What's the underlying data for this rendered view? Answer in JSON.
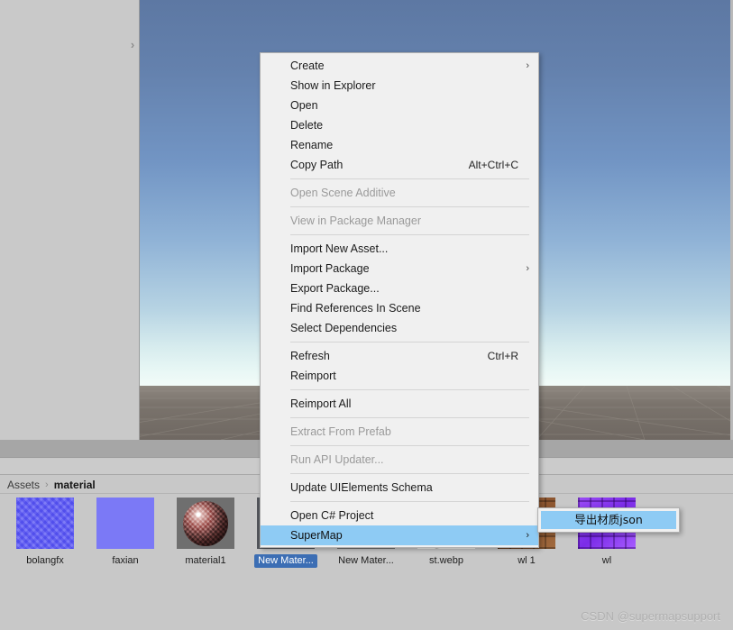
{
  "window": {
    "app": "Unity Editor",
    "watermark": "CSDN @supermapsupport"
  },
  "left_panel": {
    "expand_chevron": "chevron-right-icon",
    "chevron_glyph": "›"
  },
  "scene_view": {
    "sky_top_color": "#5d78a3",
    "sky_horizon_color": "#e8f7f5",
    "ground_color": "#76706a",
    "grid_visible": true
  },
  "project_window": {
    "breadcrumb": {
      "root": "Assets",
      "separator": "›",
      "leaf": "material"
    },
    "assets": [
      {
        "label": "bolangfx",
        "thumb": "t-bolangfx",
        "kind": "texture",
        "selected": false
      },
      {
        "label": "faxian",
        "thumb": "t-faxian",
        "kind": "texture",
        "selected": false
      },
      {
        "label": "material1",
        "thumb": "t-material1",
        "kind": "material",
        "selected": false
      },
      {
        "label": "New Mater...",
        "thumb": "t-newmat1",
        "kind": "material",
        "selected": true
      },
      {
        "label": "New Mater...",
        "thumb": "t-newmat2",
        "kind": "material",
        "selected": false
      },
      {
        "label": "st.webp",
        "thumb": "t-stwebp",
        "kind": "texture",
        "selected": false
      },
      {
        "label": "wl 1",
        "thumb": "t-wl1",
        "kind": "texture",
        "selected": false
      },
      {
        "label": "wl",
        "thumb": "t-wl",
        "kind": "texture",
        "selected": false
      }
    ]
  },
  "context_menu": {
    "highlight_color": "#8ecbf4",
    "items": [
      {
        "type": "item",
        "label": "Create",
        "shortcut": "",
        "arrow": true,
        "disabled": false,
        "highlight": false
      },
      {
        "type": "item",
        "label": "Show in Explorer",
        "shortcut": "",
        "arrow": false,
        "disabled": false,
        "highlight": false
      },
      {
        "type": "item",
        "label": "Open",
        "shortcut": "",
        "arrow": false,
        "disabled": false,
        "highlight": false
      },
      {
        "type": "item",
        "label": "Delete",
        "shortcut": "",
        "arrow": false,
        "disabled": false,
        "highlight": false
      },
      {
        "type": "item",
        "label": "Rename",
        "shortcut": "",
        "arrow": false,
        "disabled": false,
        "highlight": false
      },
      {
        "type": "item",
        "label": "Copy Path",
        "shortcut": "Alt+Ctrl+C",
        "arrow": false,
        "disabled": false,
        "highlight": false
      },
      {
        "type": "sep"
      },
      {
        "type": "item",
        "label": "Open Scene Additive",
        "shortcut": "",
        "arrow": false,
        "disabled": true,
        "highlight": false
      },
      {
        "type": "sep"
      },
      {
        "type": "item",
        "label": "View in Package Manager",
        "shortcut": "",
        "arrow": false,
        "disabled": true,
        "highlight": false
      },
      {
        "type": "sep"
      },
      {
        "type": "item",
        "label": "Import New Asset...",
        "shortcut": "",
        "arrow": false,
        "disabled": false,
        "highlight": false
      },
      {
        "type": "item",
        "label": "Import Package",
        "shortcut": "",
        "arrow": true,
        "disabled": false,
        "highlight": false
      },
      {
        "type": "item",
        "label": "Export Package...",
        "shortcut": "",
        "arrow": false,
        "disabled": false,
        "highlight": false
      },
      {
        "type": "item",
        "label": "Find References In Scene",
        "shortcut": "",
        "arrow": false,
        "disabled": false,
        "highlight": false
      },
      {
        "type": "item",
        "label": "Select Dependencies",
        "shortcut": "",
        "arrow": false,
        "disabled": false,
        "highlight": false
      },
      {
        "type": "sep"
      },
      {
        "type": "item",
        "label": "Refresh",
        "shortcut": "Ctrl+R",
        "arrow": false,
        "disabled": false,
        "highlight": false
      },
      {
        "type": "item",
        "label": "Reimport",
        "shortcut": "",
        "arrow": false,
        "disabled": false,
        "highlight": false
      },
      {
        "type": "sep"
      },
      {
        "type": "item",
        "label": "Reimport All",
        "shortcut": "",
        "arrow": false,
        "disabled": false,
        "highlight": false
      },
      {
        "type": "sep"
      },
      {
        "type": "item",
        "label": "Extract From Prefab",
        "shortcut": "",
        "arrow": false,
        "disabled": true,
        "highlight": false
      },
      {
        "type": "sep"
      },
      {
        "type": "item",
        "label": "Run API Updater...",
        "shortcut": "",
        "arrow": false,
        "disabled": true,
        "highlight": false
      },
      {
        "type": "sep"
      },
      {
        "type": "item",
        "label": "Update UIElements Schema",
        "shortcut": "",
        "arrow": false,
        "disabled": false,
        "highlight": false
      },
      {
        "type": "sep"
      },
      {
        "type": "item",
        "label": "Open C# Project",
        "shortcut": "",
        "arrow": false,
        "disabled": false,
        "highlight": false
      },
      {
        "type": "item",
        "label": "SuperMap",
        "shortcut": "",
        "arrow": true,
        "disabled": false,
        "highlight": true
      }
    ],
    "arrow_glyph": "›"
  },
  "submenu": {
    "items": [
      {
        "label": "导出材质json",
        "highlight": true
      }
    ]
  }
}
